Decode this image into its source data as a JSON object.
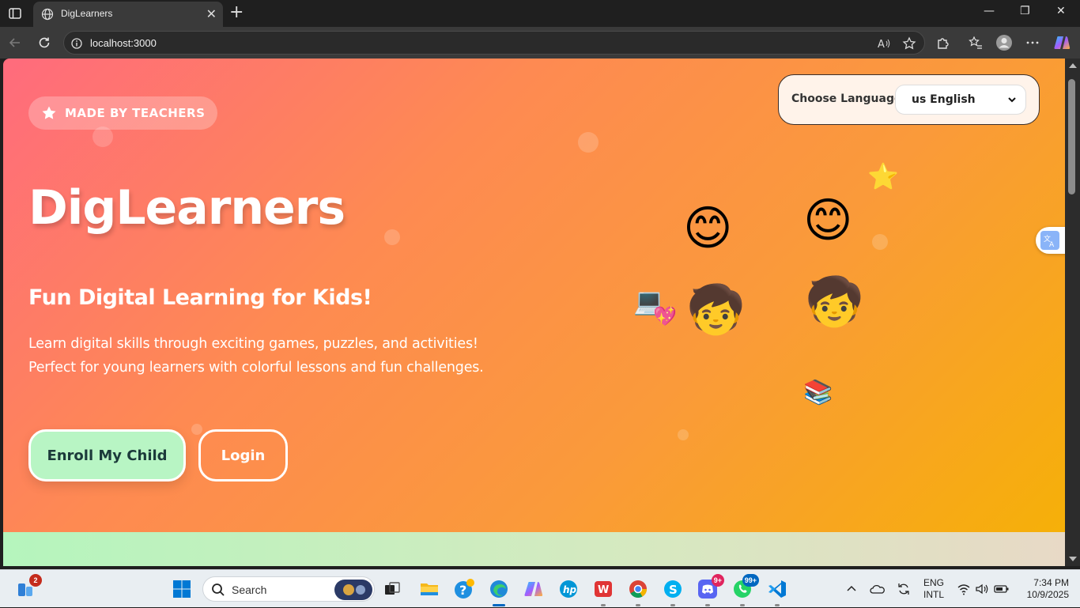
{
  "browser": {
    "tab_title": "DigLearners",
    "tab_close": "✕",
    "new_tab": "+",
    "url": "localhost:3000",
    "window_controls": {
      "minimize": "—",
      "maximize": "❐",
      "close": "✕"
    }
  },
  "hero": {
    "badge": "MADE BY TEACHERS",
    "title": "DigLearners",
    "subtitle": "Fun Digital Learning for Kids!",
    "description": "Learn digital skills through exciting games, puzzles, and activities! Perfect for young learners with colorful lessons and fun challenges.",
    "enroll_button": "Enroll My Child",
    "login_button": "Login"
  },
  "language": {
    "label": "Choose Language:",
    "selected": "us English"
  },
  "decorations": {
    "emojis": [
      "😊",
      "😊",
      "⭐",
      "🧒",
      "🧒",
      "💻",
      "💖",
      "📚"
    ]
  },
  "taskbar": {
    "widgets_badge": "2",
    "search_label": "Search",
    "discord_badge": "9+",
    "whatsapp_badge": "99+",
    "language_line1": "ENG",
    "language_line2": "INTL",
    "time": "7:34 PM",
    "date": "10/9/2025"
  },
  "colors": {
    "hero_gradient_start": "#ff6b7d",
    "hero_gradient_end": "#f6b008",
    "enroll_bg": "#b8f5c4",
    "lang_card_bg": "#fff3ea"
  }
}
